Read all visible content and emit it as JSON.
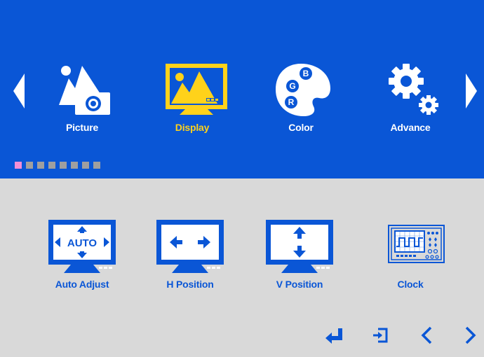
{
  "tabs": [
    {
      "label": "Picture",
      "icon": "picture-icon",
      "active": false
    },
    {
      "label": "Display",
      "icon": "display-icon",
      "active": true
    },
    {
      "label": "Color",
      "icon": "color-palette-icon",
      "active": false
    },
    {
      "label": "Advance",
      "icon": "gears-icon",
      "active": false
    }
  ],
  "palette_letters": [
    "B",
    "G",
    "R"
  ],
  "auto_text": "AUTO",
  "items": [
    {
      "label": "Auto Adjust",
      "icon": "auto-adjust-icon"
    },
    {
      "label": "H Position",
      "icon": "h-position-icon"
    },
    {
      "label": "V Position",
      "icon": "v-position-icon"
    },
    {
      "label": "Clock",
      "icon": "clock-icon"
    }
  ],
  "pager": {
    "total": 8,
    "current": 1
  },
  "nav": [
    {
      "name": "enter-icon"
    },
    {
      "name": "exit-icon"
    },
    {
      "name": "previous-icon"
    },
    {
      "name": "next-icon"
    }
  ],
  "colors": {
    "top_bg": "#0a56d6",
    "bottom_bg": "#d9d9d9",
    "active_label": "#ffd21a",
    "item_blue": "#0a56d6",
    "pager_active": "#f38fd6",
    "pager_inactive": "#9f9f9f"
  }
}
